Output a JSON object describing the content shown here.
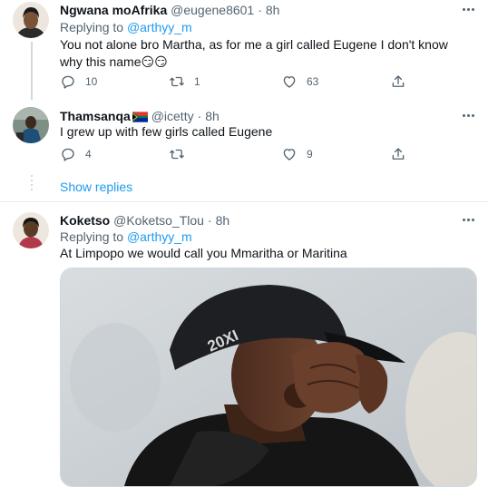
{
  "tweets": [
    {
      "name": "Ngwana moAfrika",
      "handle": "@eugene8601",
      "time": "8h",
      "replying_prefix": "Replying to",
      "replying_to": "@arthyy_m",
      "text": "You not alone bro Martha, as for me a girl called Eugene I don't know why this name😏😏",
      "replies": "10",
      "retweets": "1",
      "likes": "63"
    },
    {
      "name": "Thamsanqa",
      "flag_icon": "south-africa-flag-icon",
      "handle": "@icetty",
      "time": "8h",
      "text": "I grew up with few girls called Eugene",
      "replies": "4",
      "retweets": "",
      "likes": "9"
    },
    {
      "name": "Koketso",
      "handle": "@Koketso_Tlou",
      "time": "8h",
      "replying_prefix": "Replying to",
      "replying_to": "@arthyy_m",
      "text": "At Limpopo we would call you Mmaritha or Maritina",
      "cap_logo": "20XI"
    }
  ],
  "show_replies": "Show replies",
  "separator": "·",
  "colors": {
    "accent": "#1d9bf0",
    "secondary_text": "#536471",
    "primary_text": "#0f1419",
    "divider": "#e6ecf0"
  },
  "icons": [
    "reply-icon",
    "retweet-icon",
    "like-icon",
    "share-icon",
    "more-icon"
  ]
}
